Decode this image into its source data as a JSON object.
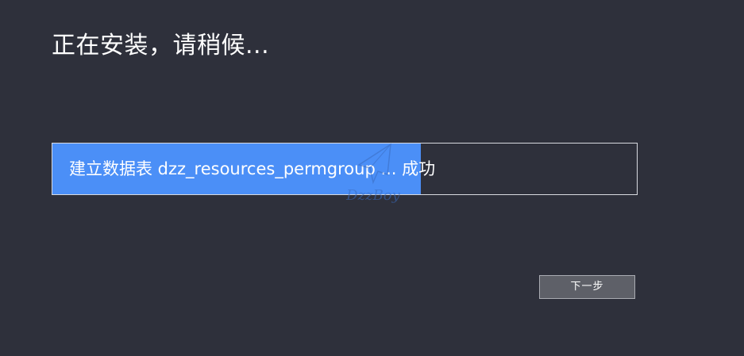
{
  "installer": {
    "title": "正在安装，请稍候...",
    "progress_status": "建立数据表 dzz_resources_permgroup ... 成功",
    "progress_fraction": 0.63,
    "next_button_label": "下一步",
    "watermark_text": "DzzBoy"
  },
  "colors": {
    "background": "#2e303b",
    "progress_fill": "#4b8ff7",
    "progress_border": "#d8dae0",
    "button_bg": "#5e6068"
  }
}
